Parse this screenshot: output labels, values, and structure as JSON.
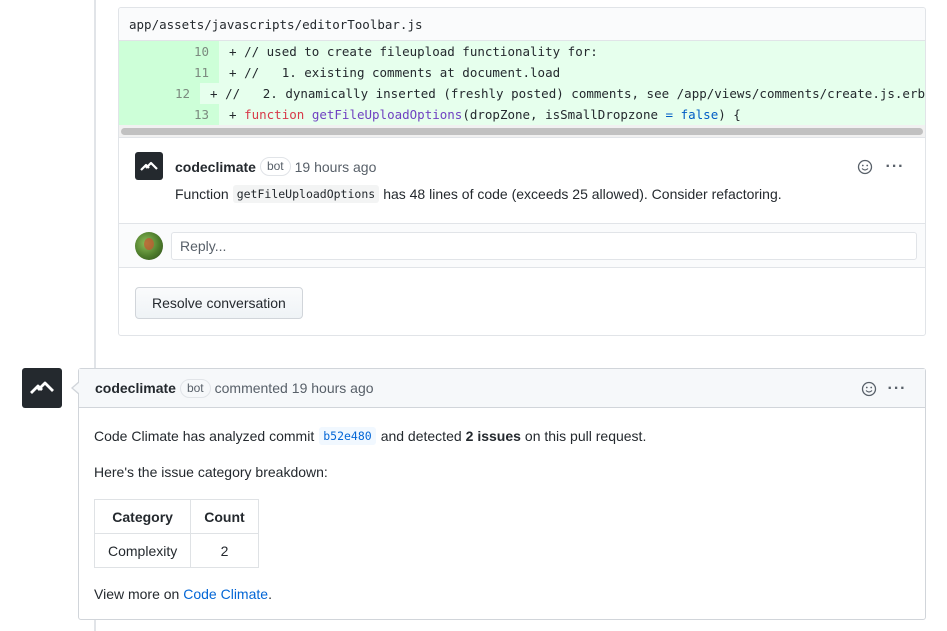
{
  "thread": {
    "file_path": "app/assets/javascripts/editorToolbar.js",
    "lines": [
      {
        "number": "10",
        "prefix": "+ ",
        "text": "// used to create fileupload functionality for:"
      },
      {
        "number": "11",
        "prefix": "+ ",
        "text": "//   1. existing comments at document.load"
      },
      {
        "number": "12",
        "prefix": "+ ",
        "text": "//   2. dynamically inserted (freshly posted) comments, see /app/views/comments/create.js.erb"
      },
      {
        "number": "13",
        "prefix": "+ ",
        "kw": "function",
        "fn": "getFileUploadOptions",
        "args_a": "(dropZone, isSmallDropzone ",
        "op": "=",
        "cst": "false",
        "args_b": ") {"
      }
    ],
    "review_comment": {
      "author": "codeclimate",
      "badge": "bot",
      "time": "19 hours ago",
      "body_before": "Function",
      "body_code": "getFileUploadOptions",
      "body_after": "has 48 lines of code (exceeds 25 allowed). Consider refactoring."
    },
    "reply_placeholder": "Reply...",
    "resolve_label": "Resolve conversation"
  },
  "timeline_comment": {
    "author": "codeclimate",
    "badge": "bot",
    "action": "commented",
    "time": "19 hours ago",
    "p1_before": "Code Climate has analyzed commit",
    "commit_sha": "b52e480",
    "p1_mid": "and detected",
    "issues": "2 issues",
    "p1_after": "on this pull request.",
    "p2": "Here's the issue category breakdown:",
    "table": {
      "headers": [
        "Category",
        "Count"
      ],
      "rows": [
        [
          "Complexity",
          "2"
        ]
      ]
    },
    "p3_before": "View more on",
    "p3_link": "Code Climate",
    "p3_after": "."
  },
  "icons": {
    "emoji": "smiley-icon",
    "more": "kebab-icon",
    "logo": "codeclimate-logo-icon"
  }
}
